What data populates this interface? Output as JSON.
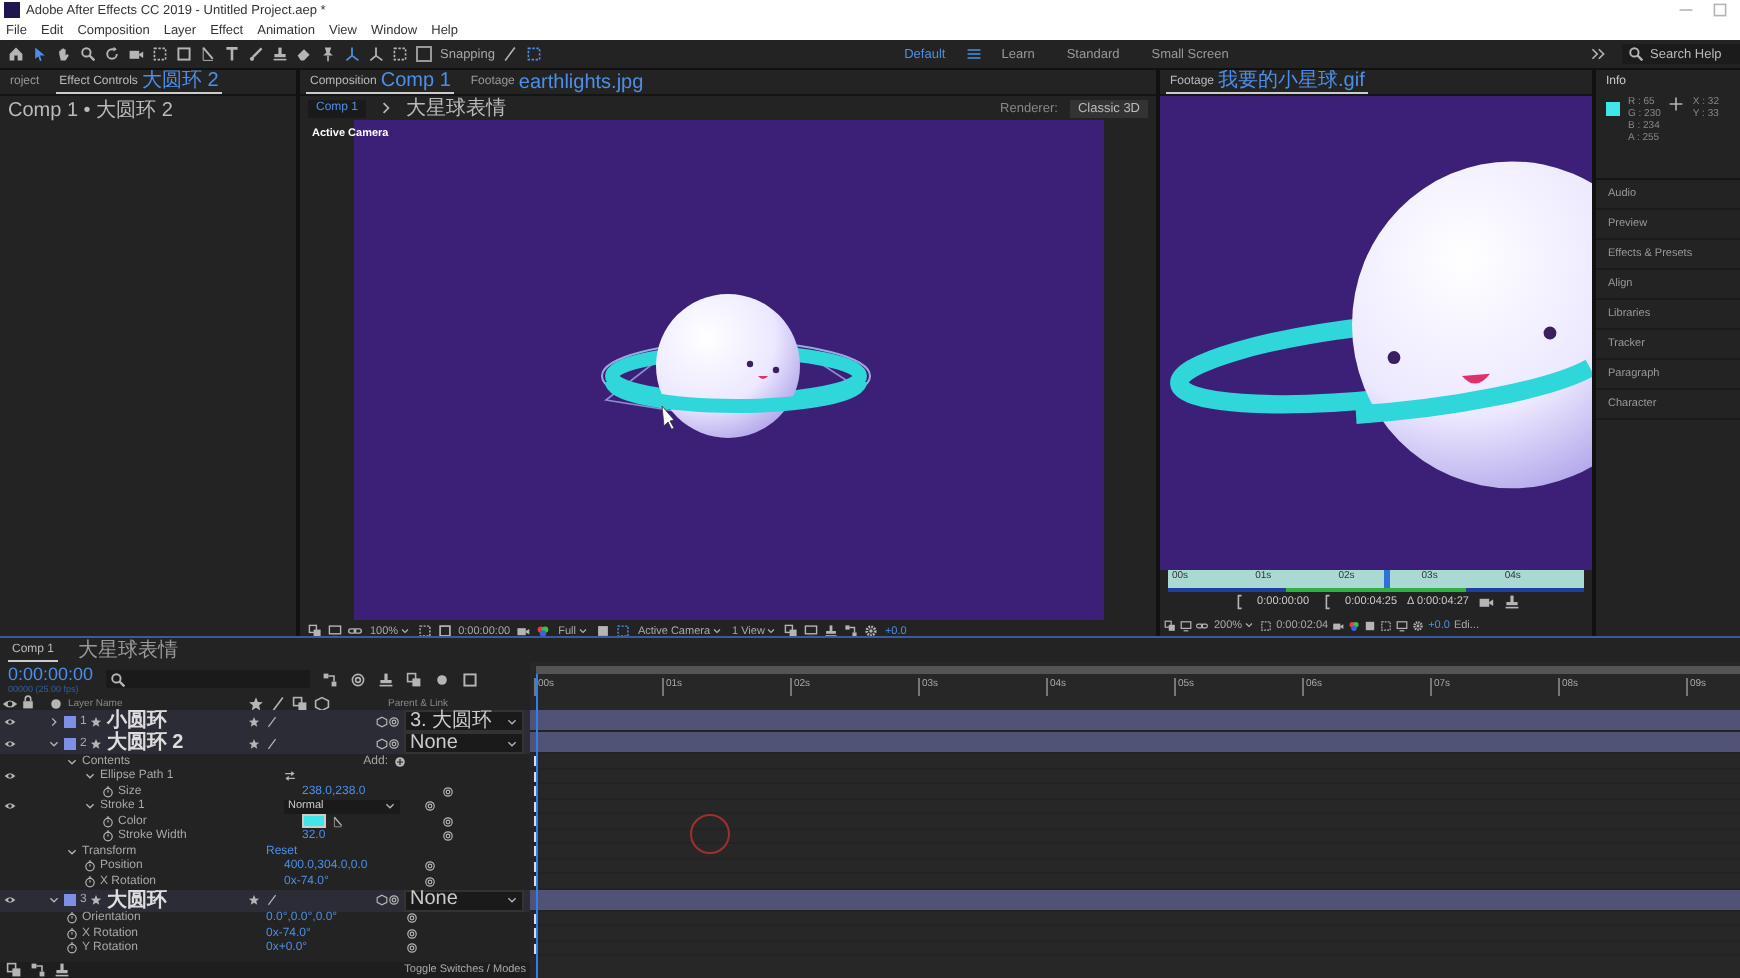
{
  "window": {
    "title": "Adobe After Effects CC 2019 - Untitled Project.aep *"
  },
  "menu": [
    "File",
    "Edit",
    "Composition",
    "Layer",
    "Effect",
    "Animation",
    "View",
    "Window",
    "Help"
  ],
  "toolbar": {
    "snapping": {
      "label": "Snapping",
      "checked": false
    }
  },
  "workspaces": [
    {
      "label": "Default",
      "selected": true
    },
    {
      "label": "Learn",
      "selected": false
    },
    {
      "label": "Standard",
      "selected": false
    },
    {
      "label": "Small Screen",
      "selected": false
    }
  ],
  "search": {
    "placeholder": "Search Help"
  },
  "left_panel": {
    "tabs": [
      {
        "label": "roject",
        "selected": false
      },
      {
        "label": "Effect Controls",
        "name": "大圆环 2",
        "selected": true
      }
    ],
    "breadcrumb": "Comp 1 • 大圆环 2"
  },
  "composition": {
    "tabs": [
      {
        "label": "Composition",
        "name": "Comp 1",
        "selected": true
      },
      {
        "label": "Footage",
        "name": "earthlights.jpg",
        "selected": false
      }
    ],
    "flow": [
      {
        "label": "Comp 1",
        "selected": true
      },
      {
        "label": "大星球表情",
        "selected": false
      }
    ],
    "renderer_label": "Renderer:",
    "renderer": "Classic 3D",
    "view_label": "Active Camera",
    "controls": {
      "zoom": "100%",
      "time": "0:00:00:00",
      "resolution": "Full",
      "camera": "Active Camera",
      "views": "1 View",
      "exposure": "+0.0"
    }
  },
  "footage": {
    "tab": {
      "label": "Footage",
      "name": "我要的小星球.gif",
      "selected": true
    },
    "ruler": [
      "00s",
      "01s",
      "02s",
      "03s",
      "04s"
    ],
    "level": 0.52,
    "in": "0:00:00:00",
    "out": "0:00:04:25",
    "duration": "Δ 0:00:04:27",
    "controls": {
      "zoom": "200%",
      "time": "0:00:02:04",
      "exposure": "+0.0",
      "edit": "Edi..."
    }
  },
  "info": {
    "title": "Info",
    "color": "#41e6ea",
    "channels": [
      "R : 65",
      "G : 230",
      "B : 234",
      "A : 255"
    ],
    "coords": [
      "X : 32",
      "Y : 33"
    ]
  },
  "panels": [
    "Audio",
    "Preview",
    "Effects & Presets",
    "Align",
    "Libraries",
    "Tracker",
    "Paragraph",
    "Character"
  ],
  "timeline": {
    "tabs": [
      {
        "label": "Comp 1",
        "selected": true
      },
      {
        "label": "大星球表情",
        "selected": false
      }
    ],
    "time": "0:00:00:00",
    "fps": "00000 (25.00 fps)",
    "columns": {
      "name": "Layer Name",
      "parent": "Parent & Link"
    },
    "ruler": [
      "00s",
      "01s",
      "02s",
      "03s",
      "04s",
      "05s",
      "06s",
      "07s",
      "08s",
      "09s"
    ],
    "level": 0,
    "layers": [
      {
        "kind": "layer",
        "number": "1",
        "name": "小圆环",
        "visible": true,
        "expanded": false,
        "parent": "3. 大圆环"
      },
      {
        "kind": "layer",
        "number": "2",
        "name": "大圆环 2",
        "visible": true,
        "expanded": true,
        "parent": "None",
        "children": [
          {
            "kind": "group",
            "name": "Contents",
            "visible": false,
            "expanded": true,
            "action": "Add:",
            "children": [
              {
                "kind": "group",
                "name": "Ellipse Path 1",
                "visible": true,
                "expanded": true,
                "children": [
                  {
                    "kind": "property",
                    "name": "Size",
                    "value": "238.0,238.0"
                  }
                ]
              },
              {
                "kind": "group",
                "name": "Stroke 1",
                "visible": true,
                "expanded": true,
                "mode": "Normal",
                "children": [
                  {
                    "kind": "color",
                    "name": "Color",
                    "color": "#41e6ea"
                  },
                  {
                    "kind": "property",
                    "name": "Stroke Width",
                    "value": "32.0"
                  }
                ]
              }
            ]
          },
          {
            "kind": "group",
            "name": "Transform",
            "visible": false,
            "expanded": true,
            "value": "Reset",
            "children": [
              {
                "kind": "property",
                "name": "Position",
                "value": "400.0,304.0,0.0"
              },
              {
                "kind": "property",
                "name": "X Rotation",
                "value": "0x-74.0°"
              }
            ]
          }
        ]
      },
      {
        "kind": "layer",
        "number": "3",
        "name": "大圆环",
        "visible": true,
        "expanded": true,
        "parent": "None",
        "children": [
          {
            "kind": "property",
            "name": "Orientation",
            "value": "0.0°,0.0°,0.0°"
          },
          {
            "kind": "property",
            "name": "X Rotation",
            "value": "0x-74.0°"
          },
          {
            "kind": "property",
            "name": "Y Rotation",
            "value": "0x+0.0°"
          }
        ]
      }
    ],
    "footer": "Toggle Switches / Modes"
  }
}
